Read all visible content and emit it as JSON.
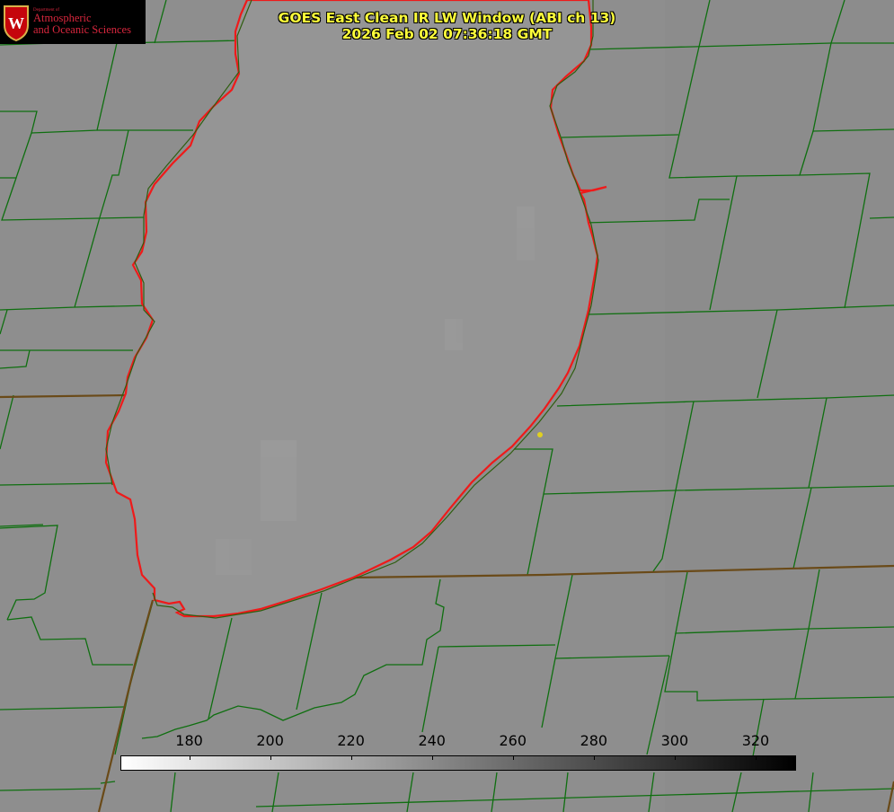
{
  "logo": {
    "department": "Department of",
    "line1": "Atmospheric",
    "line2": "and Oceanic Sciences",
    "seal_letter": "W"
  },
  "title": {
    "line1": "GOES East Clean IR LW Window (ABI ch 13)",
    "line2": "2026 Feb 02 07:36:18 GMT"
  },
  "colorbar": {
    "tick_labels": [
      "180",
      "200",
      "220",
      "240",
      "260",
      "280",
      "300",
      "320"
    ],
    "scale_min": 163,
    "scale_max": 330,
    "color_low": "#ffffff",
    "color_high": "#000000"
  },
  "colors": {
    "background": "#8e8e8e",
    "county_lines": "#0f6f10",
    "state_lines": "#6a4a18",
    "lake_outline": "#ef1a1a",
    "title_text": "#ffff3a",
    "marker": "#e0d020"
  }
}
